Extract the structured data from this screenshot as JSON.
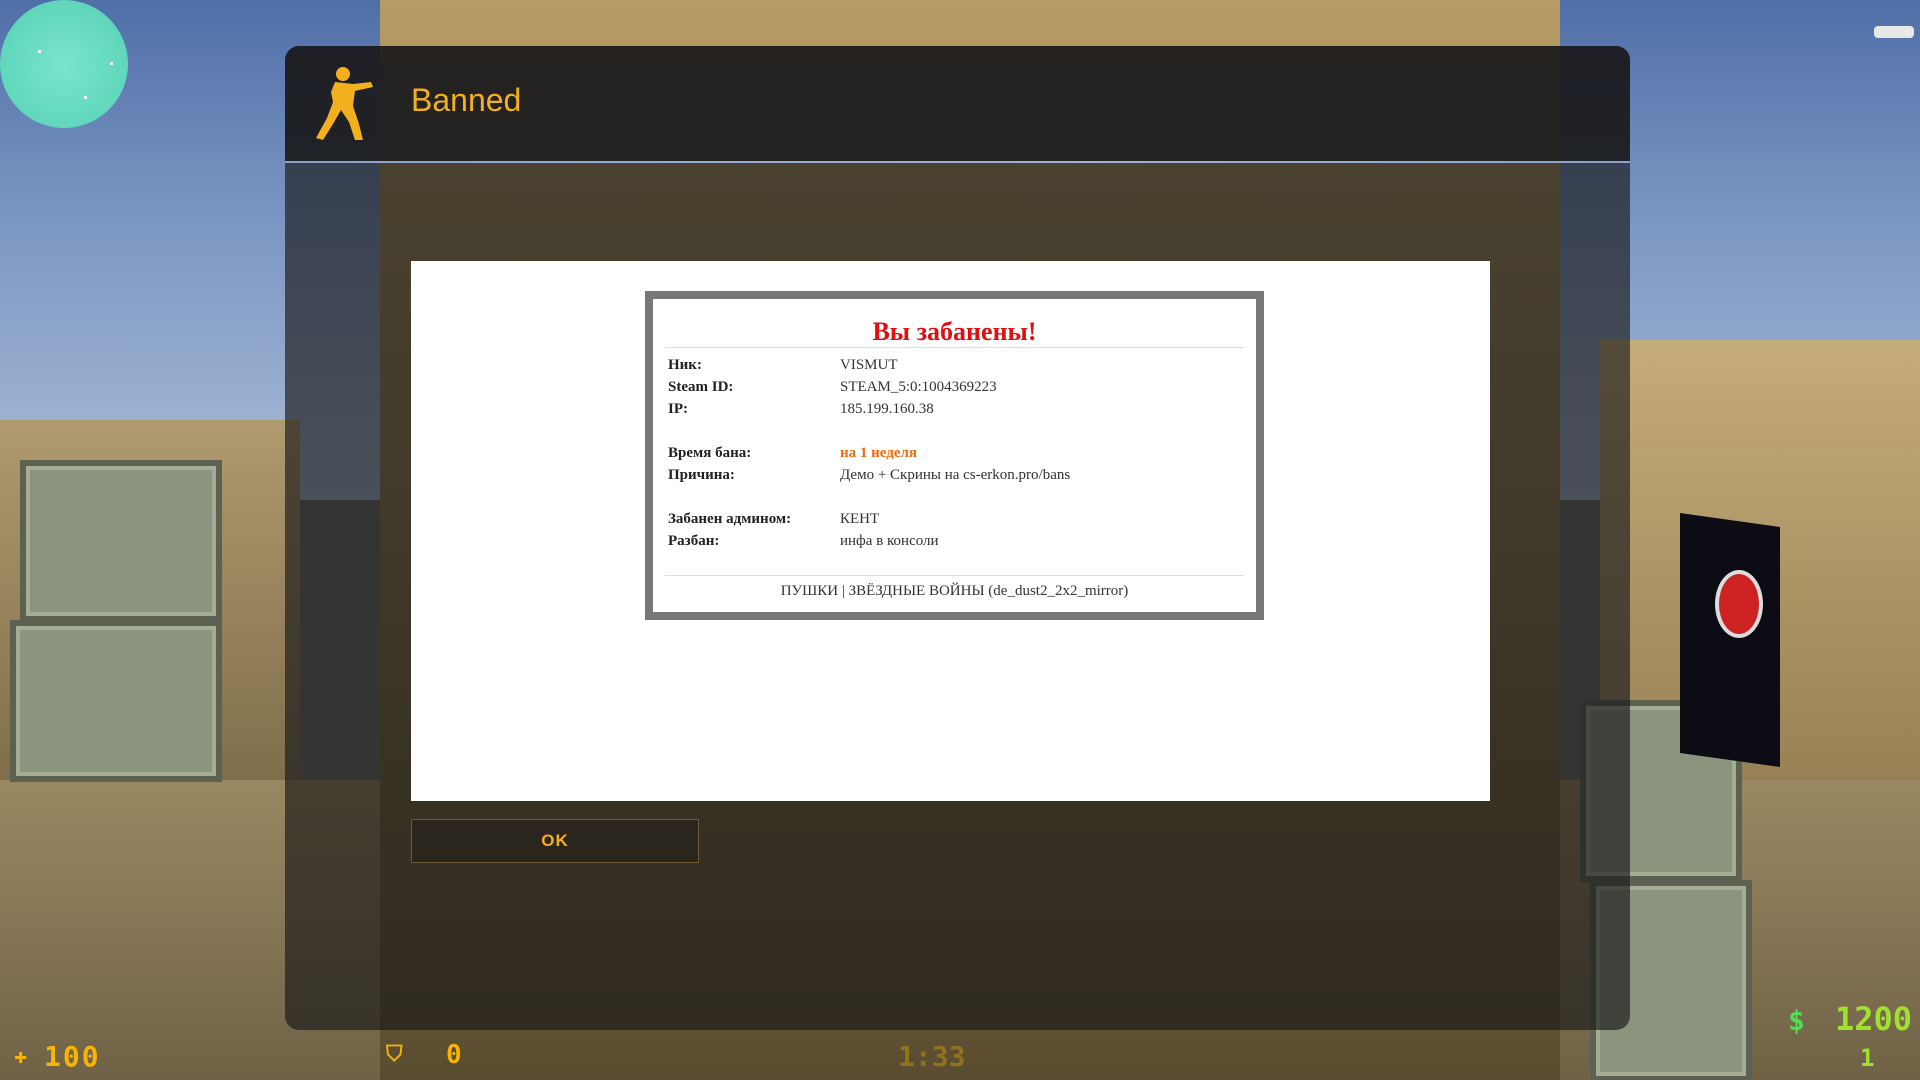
{
  "window": {
    "title": "Banned",
    "logo_icon": "counter-terrorist-silhouette-icon",
    "accent_color": "#f3b01e"
  },
  "ban": {
    "heading": "Вы забанены!",
    "nick_label": "Ник:",
    "nick_value": "VISMUT",
    "steamid_label": "Steam ID:",
    "steamid_value": "STEAM_5:0:1004369223",
    "ip_label": "IP:",
    "ip_value": "185.199.160.38",
    "duration_label": "Время бана:",
    "duration_value": "на 1 неделя",
    "reason_label": "Причина:",
    "reason_value": "Демо + Скрины на cs-erkon.pro/bans",
    "admin_label": "Забанен админом:",
    "admin_value": "КЕНТ",
    "unban_label": "Разбан:",
    "unban_value": "инфа в консоли",
    "footer": "ПУШКИ | ЗВЁЗДНЫЕ ВОЙНЫ (de_dust2_2x2_mirror)",
    "heading_color": "#e01010",
    "duration_color": "#f06a10"
  },
  "buttons": {
    "ok_label": "OK"
  },
  "hud": {
    "health": "100",
    "armor": "0",
    "timer": "1:33",
    "money_symbol": "$",
    "money": "1200",
    "ammo": "1"
  }
}
